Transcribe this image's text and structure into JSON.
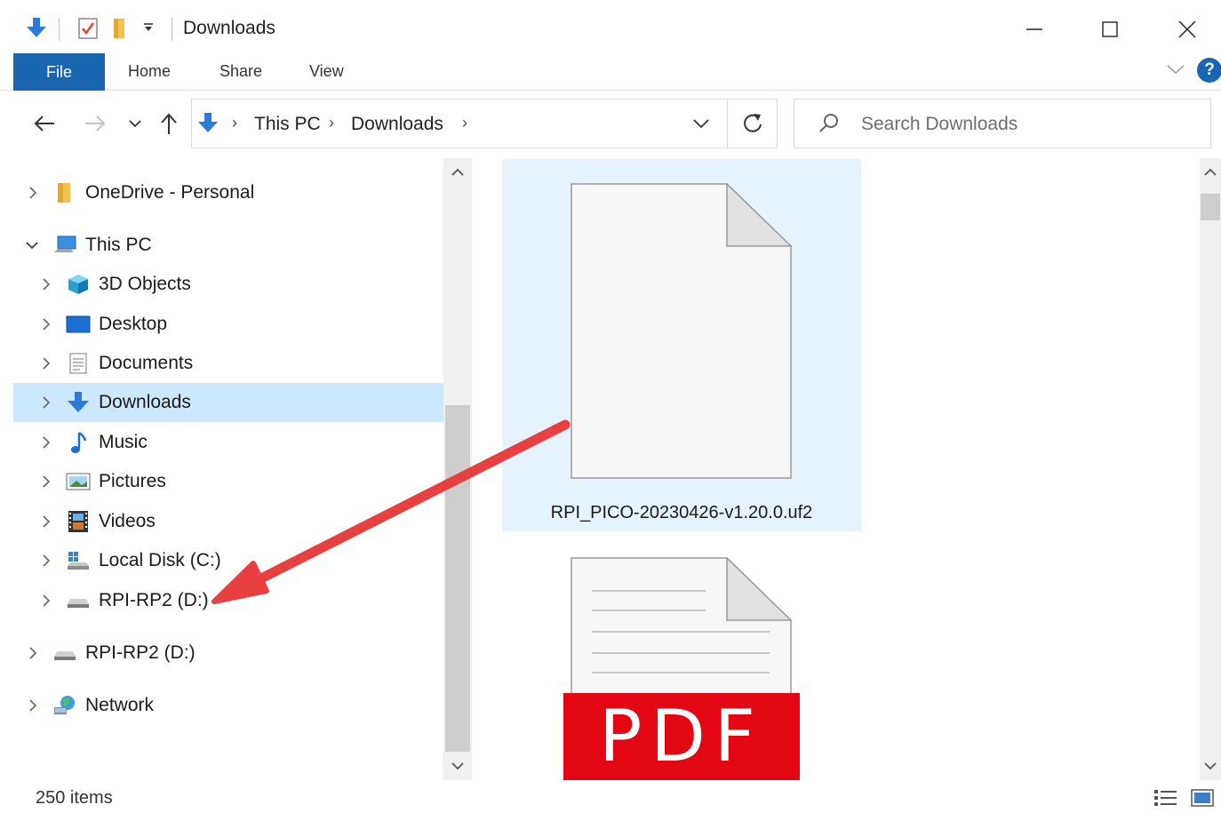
{
  "window": {
    "title": "Downloads",
    "controls": {
      "minimize": "minimize",
      "maximize": "maximize",
      "close": "close"
    }
  },
  "ribbon": {
    "tabs": [
      {
        "label": "File"
      },
      {
        "label": "Home"
      },
      {
        "label": "Share"
      },
      {
        "label": "View"
      }
    ],
    "help_label": "?"
  },
  "address": {
    "path": [
      "This PC",
      "Downloads"
    ],
    "separator": "›"
  },
  "search": {
    "placeholder": "Search Downloads"
  },
  "nav_tree": {
    "items": [
      {
        "label": "OneDrive - Personal",
        "icon": "folder-icon",
        "expanded": false
      },
      {
        "label": "This PC",
        "icon": "computer-icon",
        "expanded": true
      },
      {
        "label": "3D Objects",
        "icon": "3d-objects-icon",
        "expanded": false
      },
      {
        "label": "Desktop",
        "icon": "desktop-icon",
        "expanded": false
      },
      {
        "label": "Documents",
        "icon": "documents-icon",
        "expanded": false
      },
      {
        "label": "Downloads",
        "icon": "download-icon",
        "expanded": false,
        "selected": true
      },
      {
        "label": "Music",
        "icon": "music-icon",
        "expanded": false
      },
      {
        "label": "Pictures",
        "icon": "pictures-icon",
        "expanded": false
      },
      {
        "label": "Videos",
        "icon": "videos-icon",
        "expanded": false
      },
      {
        "label": "Local Disk (C:)",
        "icon": "local-disk-icon",
        "expanded": false
      },
      {
        "label": "RPI-RP2 (D:)",
        "icon": "drive-icon",
        "expanded": false
      },
      {
        "label": "RPI-RP2 (D:)",
        "icon": "drive-icon",
        "expanded": false
      },
      {
        "label": "Network",
        "icon": "network-icon",
        "expanded": false
      }
    ]
  },
  "files": [
    {
      "name": "RPI_PICO-20230426-v1.20.0.uf2",
      "icon": "generic-file-icon",
      "selected": true
    },
    {
      "name": "",
      "icon": "pdf-file-icon",
      "badge": "PDF",
      "selected": false
    }
  ],
  "status_bar": {
    "item_count": "250 items"
  },
  "colors": {
    "accent": "#1a65b0",
    "selection": "#cce8ff",
    "file_selection": "#e5f3ff",
    "annotation_arrow": "#e84040",
    "pdf_red": "#e30613"
  }
}
